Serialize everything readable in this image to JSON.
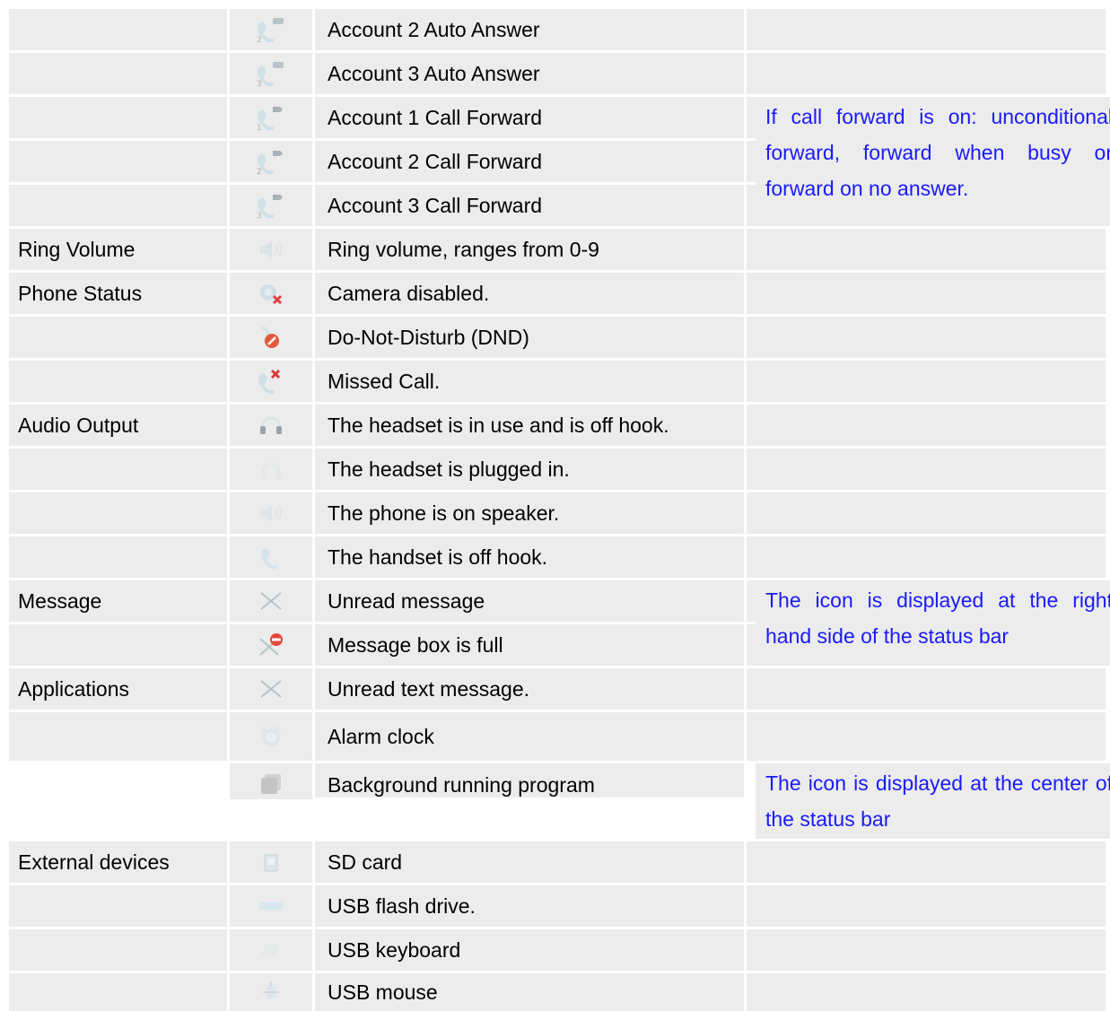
{
  "rows": [
    {
      "category": "",
      "icon": "account-2-auto-answer-icon",
      "description": "Account 2 Auto Answer"
    },
    {
      "category": "",
      "icon": "account-3-auto-answer-icon",
      "description": "Account 3 Auto Answer"
    },
    {
      "category": "",
      "icon": "account-1-call-forward-icon",
      "description": "Account 1 Call Forward"
    },
    {
      "category": "",
      "icon": "account-2-call-forward-icon",
      "description": "Account 2 Call Forward"
    },
    {
      "category": "",
      "icon": "account-3-call-forward-icon",
      "description": "Account 3 Call Forward"
    },
    {
      "category": "Ring Volume",
      "icon": "ring-volume-icon",
      "description": "Ring volume, ranges from 0-9"
    },
    {
      "category": "Phone Status",
      "icon": "camera-disabled-icon",
      "description": "Camera disabled."
    },
    {
      "category": "",
      "icon": "dnd-icon",
      "description": "Do-Not-Disturb (DND)"
    },
    {
      "category": "",
      "icon": "missed-call-icon",
      "description": "Missed Call."
    },
    {
      "category": "Audio Output",
      "icon": "headset-off-hook-icon",
      "description": "The headset is in use and is off hook."
    },
    {
      "category": "",
      "icon": "headset-plugged-icon",
      "description": "The headset is plugged in."
    },
    {
      "category": "",
      "icon": "speaker-icon",
      "description": "The phone is on speaker."
    },
    {
      "category": "",
      "icon": "handset-off-hook-icon",
      "description": "The handset is off hook."
    },
    {
      "category": "Message",
      "icon": "unread-message-icon",
      "description": "Unread message"
    },
    {
      "category": "",
      "icon": "message-box-full-icon",
      "description": "Message box is full"
    },
    {
      "category": "Applications",
      "icon": "unread-text-message-icon",
      "description": "Unread text message."
    },
    {
      "category": "",
      "icon": "alarm-clock-icon",
      "description": "Alarm clock"
    },
    {
      "category": "",
      "icon": "background-program-icon",
      "description": "Background running program"
    },
    {
      "category": "External devices",
      "icon": "sd-card-icon",
      "description": "SD card"
    },
    {
      "category": "",
      "icon": "usb-flash-drive-icon",
      "description": "USB flash drive."
    },
    {
      "category": "",
      "icon": "usb-keyboard-icon",
      "description": "USB keyboard"
    },
    {
      "category": "",
      "icon": "usb-mouse-icon",
      "description": "USB mouse"
    }
  ],
  "notes": {
    "call_forward": "If call forward is on: unconditional forward, forward when busy or forward on no answer.",
    "message": "The icon is displayed at the right hand side of the status bar",
    "applications": "The icon is displayed at the center of the status bar"
  },
  "colors": {
    "note_text": "#1a1aff",
    "cell_bg": "#ececec"
  }
}
